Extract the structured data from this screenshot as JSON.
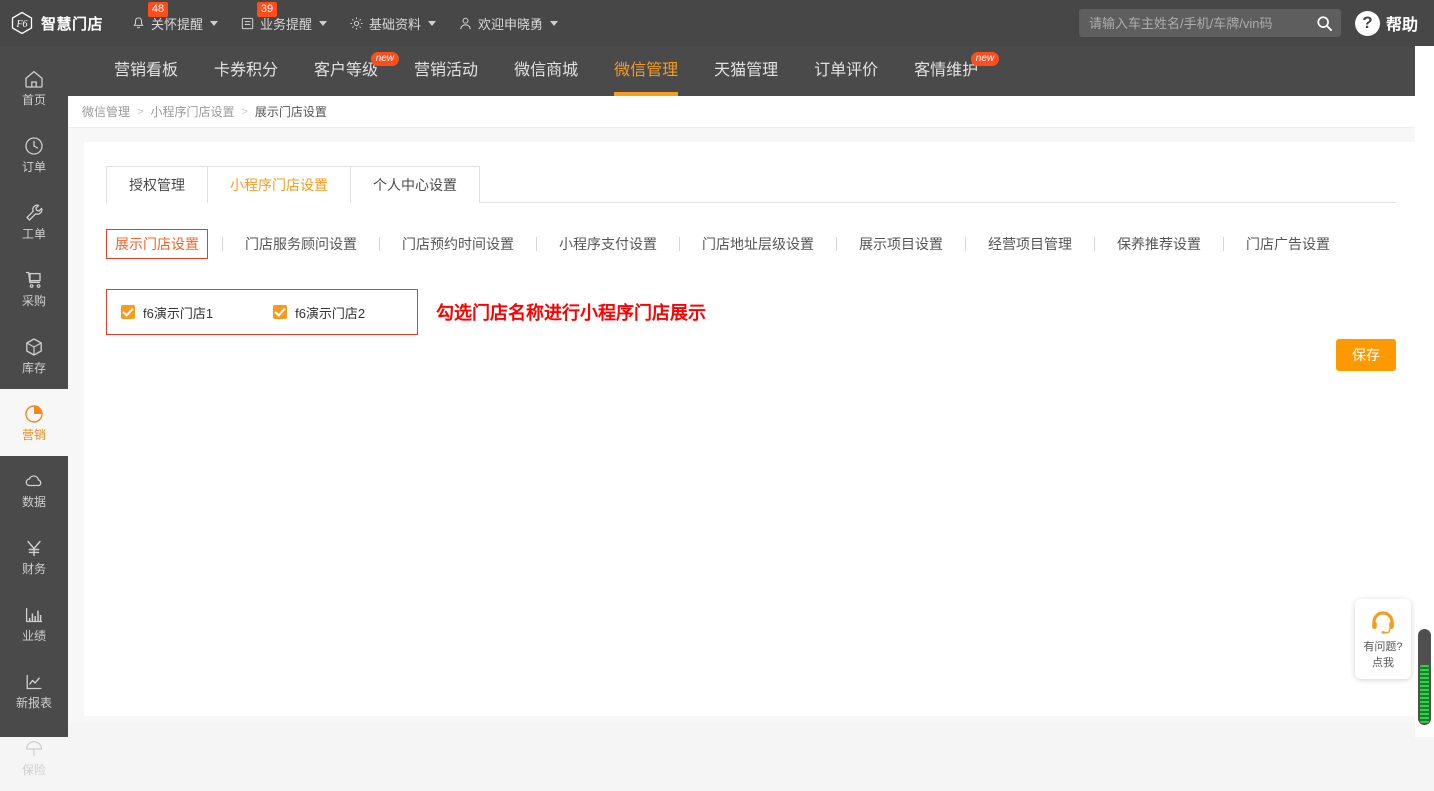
{
  "topbar": {
    "logo_text": "智慧门店",
    "logo_icon": "f6-hexagon-logo",
    "menu": [
      {
        "label": "关怀提醒",
        "icon": "bell-icon",
        "badge": "48",
        "caret": true
      },
      {
        "label": "业务提醒",
        "icon": "list-icon",
        "badge": "39",
        "caret": true
      },
      {
        "label": "基础资料",
        "icon": "gear-icon",
        "badge": "",
        "caret": true
      },
      {
        "label": "欢迎申晓勇",
        "icon": "user-icon",
        "badge": "",
        "caret": true
      }
    ],
    "search": {
      "placeholder": "请输入车主姓名/手机/车牌/vin码",
      "value": "",
      "icon": "search-icon"
    },
    "help": {
      "glyph": "?",
      "label": "帮助",
      "icon": "question-mark-icon"
    }
  },
  "sidebar": {
    "items": [
      {
        "label": "首页",
        "icon": "home-icon",
        "active": false
      },
      {
        "label": "订单",
        "icon": "clock-icon",
        "active": false
      },
      {
        "label": "工单",
        "icon": "wrench-icon",
        "active": false
      },
      {
        "label": "采购",
        "icon": "cart-icon",
        "active": false
      },
      {
        "label": "库存",
        "icon": "box-icon",
        "active": false
      },
      {
        "label": "营销",
        "icon": "pie-chart-icon",
        "active": true
      },
      {
        "label": "数据",
        "icon": "cloud-icon",
        "active": false
      },
      {
        "label": "财务",
        "icon": "yen-icon",
        "active": false
      },
      {
        "label": "业绩",
        "icon": "bar-chart-icon",
        "active": false
      },
      {
        "label": "新报表",
        "icon": "line-chart-icon",
        "active": false
      },
      {
        "label": "保险",
        "icon": "umbrella-icon",
        "active": false
      }
    ]
  },
  "navtabs": [
    {
      "label": "营销看板",
      "active": false,
      "badge": ""
    },
    {
      "label": "卡券积分",
      "active": false,
      "badge": ""
    },
    {
      "label": "客户等级",
      "active": false,
      "badge": "new"
    },
    {
      "label": "营销活动",
      "active": false,
      "badge": ""
    },
    {
      "label": "微信商城",
      "active": false,
      "badge": ""
    },
    {
      "label": "微信管理",
      "active": true,
      "badge": ""
    },
    {
      "label": "天猫管理",
      "active": false,
      "badge": ""
    },
    {
      "label": "订单评价",
      "active": false,
      "badge": ""
    },
    {
      "label": "客情维护",
      "active": false,
      "badge": "new"
    }
  ],
  "breadcrumb": [
    {
      "label": "微信管理",
      "current": false
    },
    {
      "label": "小程序门店设置",
      "current": false
    },
    {
      "label": "展示门店设置",
      "current": true
    }
  ],
  "breadcrumb_sep": "〉",
  "tabgroup": [
    {
      "label": "授权管理",
      "active": false
    },
    {
      "label": "小程序门店设置",
      "active": true
    },
    {
      "label": "个人中心设置",
      "active": false
    }
  ],
  "subtabs": [
    {
      "label": "展示门店设置",
      "active": true
    },
    {
      "label": "门店服务顾问设置",
      "active": false
    },
    {
      "label": "门店预约时间设置",
      "active": false
    },
    {
      "label": "小程序支付设置",
      "active": false
    },
    {
      "label": "门店地址层级设置",
      "active": false
    },
    {
      "label": "展示项目设置",
      "active": false
    },
    {
      "label": "经营项目管理",
      "active": false
    },
    {
      "label": "保养推荐设置",
      "active": false
    },
    {
      "label": "门店广告设置",
      "active": false
    }
  ],
  "stores": [
    {
      "label": "f6演示门店1",
      "checked": true
    },
    {
      "label": "f6演示门店2",
      "checked": true
    }
  ],
  "annotation": "勾选门店名称进行小程序门店展示",
  "save_label": "保存",
  "chat_widget": {
    "icon": "headset-support-icon",
    "line1": "有问题?",
    "line2": "点我"
  },
  "colors": {
    "accent_orange": "#f79c1e",
    "save_orange": "#fe9a00",
    "badge_red": "#ff4d1c",
    "annotation_red": "#ff0000",
    "header_dark": "#474747",
    "sidebar_dark": "#4a4a4a",
    "checkbox_orange": "#fa9a1c",
    "highlight_border": "#ec3b22"
  }
}
